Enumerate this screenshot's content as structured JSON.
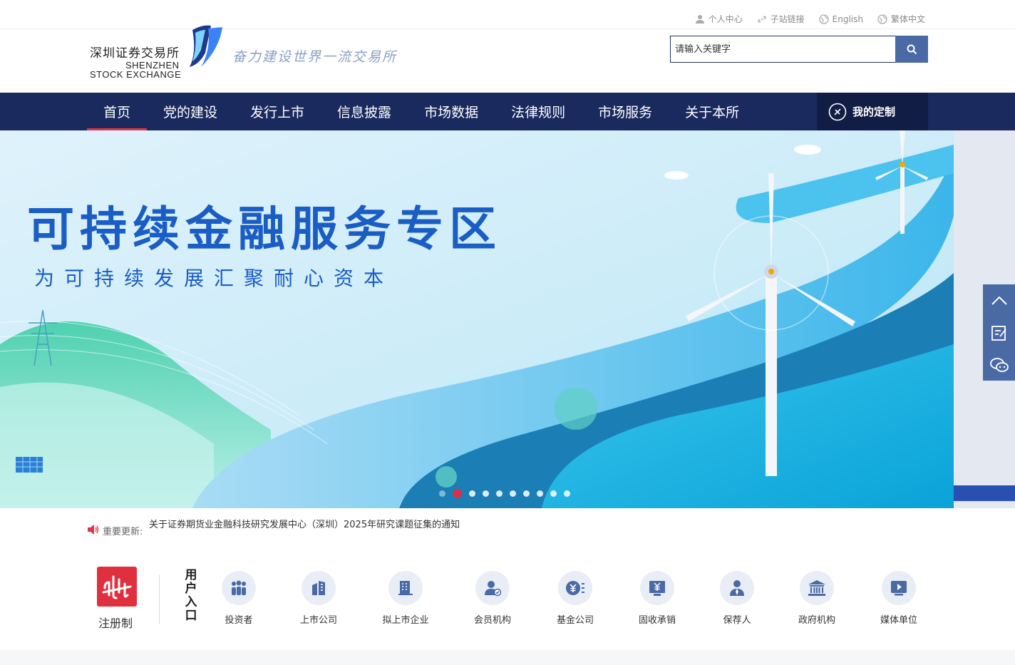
{
  "header": {
    "logo_cn": "深圳证券交易所",
    "logo_en_line1": "SHENZHEN",
    "logo_en_line2": "STOCK EXCHANGE",
    "slogan": "奋力建设世界一流交易所",
    "top_links": [
      "个人中心",
      "子站链接",
      "English",
      "繁体中文"
    ],
    "search": {
      "placeholder": "请输入关键字"
    }
  },
  "nav": {
    "items": [
      "首页",
      "党的建设",
      "发行上市",
      "信息披露",
      "市场数据",
      "法律规则",
      "市场服务",
      "关于本所"
    ],
    "active": 0,
    "custom_label": "我的定制"
  },
  "banner": {
    "title": "可持续金融服务专区",
    "subtitle": "为可持续发展汇聚耐心资本",
    "slide_count": 10,
    "active_slide": 1
  },
  "notice": {
    "label": "重要更新:",
    "text": "关于证券期货业金融科技研究发展中心（深圳）2025年研究课题征集的通知"
  },
  "entries": {
    "registration_label": "注册制",
    "title": "用户入口",
    "items": [
      "投资者",
      "上市公司",
      "拟上市企业",
      "会员机构",
      "基金公司",
      "固收承销",
      "保荐人",
      "政府机构",
      "媒体单位"
    ]
  },
  "colors": {
    "nav_bg": "#1a2a5e",
    "accent_red": "#d9374a",
    "search_button": "#4a6aa6",
    "banner_title": "#1a5dc4"
  }
}
